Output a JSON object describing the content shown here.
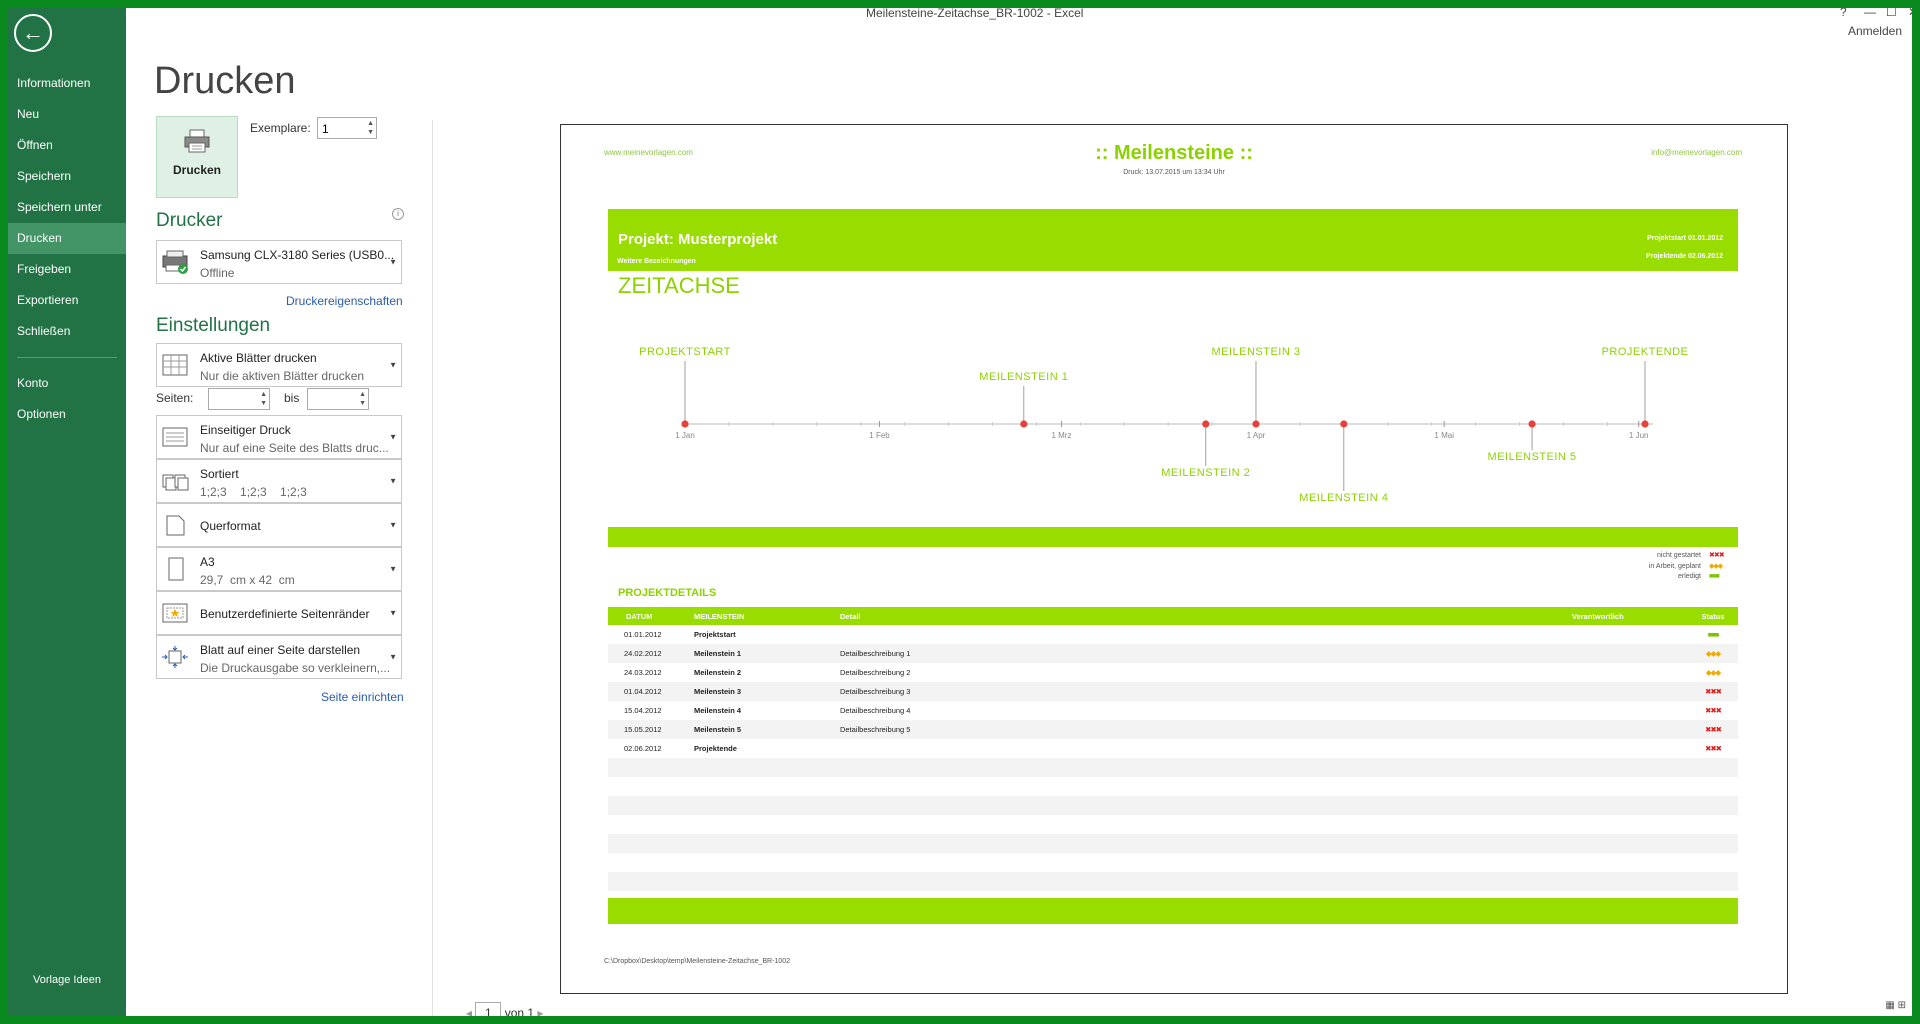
{
  "window": {
    "title": "Meilensteine-Zeitachse_BR-1002 - Excel",
    "help": "?",
    "minimize": "—",
    "maximize": "☐",
    "close": "✕",
    "sign_in": "Anmelden"
  },
  "sidebar": {
    "items": [
      {
        "label": "Informationen"
      },
      {
        "label": "Neu"
      },
      {
        "label": "Öffnen"
      },
      {
        "label": "Speichern"
      },
      {
        "label": "Speichern unter"
      },
      {
        "label": "Drucken"
      },
      {
        "label": "Freigeben"
      },
      {
        "label": "Exportieren"
      },
      {
        "label": "Schließen"
      },
      {
        "label": "Konto"
      },
      {
        "label": "Optionen"
      }
    ],
    "footer": "Vorlage Ideen"
  },
  "print": {
    "heading": "Drucken",
    "button": "Drucken",
    "copies_label": "Exemplare:",
    "copies_value": "1",
    "printer_heading": "Drucker",
    "printer_name": "Samsung CLX-3180 Series (USB0...",
    "printer_status": "Offline",
    "printer_props": "Druckereigenschaften",
    "settings_heading": "Einstellungen",
    "scope_t1": "Aktive Blätter drucken",
    "scope_t2": "Nur die aktiven Blätter drucken",
    "pages_label": "Seiten:",
    "pages_to": "bis",
    "sides_t1": "Einseitiger Druck",
    "sides_t2": "Nur auf eine Seite des Blatts druc...",
    "collate_t1": "Sortiert",
    "collate_t2": "1;2;3    1;2;3    1;2;3",
    "orientation": "Querformat",
    "paper_t1": "A3",
    "paper_t2": "29,7  cm x 42  cm",
    "margins": "Benutzerdefinierte Seitenränder",
    "scale_t1": "Blatt auf einer Seite darstellen",
    "scale_t2": "Die Druckausgabe so verkleinern,...",
    "page_setup": "Seite einrichten"
  },
  "preview": {
    "url_left": "www.meinevorlagen.com",
    "url_right": "info@meinevorlagen.com",
    "title": ":: Meilensteine ::",
    "print_date": "Druck: 13.07.2015 um 13:34 Uhr",
    "project": "Projekt: Musterprojekt",
    "project_sub": "Weitere Bezeichnungen",
    "project_start": "Projektstart  01.01.2012",
    "project_end": "Projektende  02.06.2012",
    "timeline_heading": "ZEITACHSE",
    "legend": [
      {
        "label": "nicht gestartet",
        "symbol": "✖✖✖",
        "color": "#e21a1a"
      },
      {
        "label": "in Arbeit, geplant",
        "symbol": "◆◆◆",
        "color": "#f2a900"
      },
      {
        "label": "erledigt",
        "symbol": "■■■",
        "color": "#7cc300"
      }
    ],
    "details_heading": "PROJEKTDETAILS",
    "table_headers": {
      "date": "DATUM",
      "milestone": "MEILENSTEIN",
      "detail": "Detail",
      "owner": "Verantwortlich",
      "status": "Status"
    },
    "rows": [
      {
        "date": "01.01.2012",
        "milestone": "Projektstart",
        "detail": "",
        "status": "■■■",
        "status_kind": "done"
      },
      {
        "date": "24.02.2012",
        "milestone": "Meilenstein 1",
        "detail": "Detailbeschreibung 1",
        "status": "◆◆◆",
        "status_kind": "planned"
      },
      {
        "date": "24.03.2012",
        "milestone": "Meilenstein 2",
        "detail": "Detailbeschreibung 2",
        "status": "◆◆◆",
        "status_kind": "planned"
      },
      {
        "date": "01.04.2012",
        "milestone": "Meilenstein 3",
        "detail": "Detailbeschreibung 3",
        "status": "✖✖✖",
        "status_kind": "notstarted"
      },
      {
        "date": "15.04.2012",
        "milestone": "Meilenstein 4",
        "detail": "Detailbeschreibung 4",
        "status": "✖✖✖",
        "status_kind": "notstarted"
      },
      {
        "date": "15.05.2012",
        "milestone": "Meilenstein 5",
        "detail": "Detailbeschreibung 5",
        "status": "✖✖✖",
        "status_kind": "notstarted"
      },
      {
        "date": "02.06.2012",
        "milestone": "Projektende",
        "detail": "",
        "status": "✖✖✖",
        "status_kind": "notstarted"
      }
    ],
    "file_path": "C:\\Dropbox\\Desktop\\temp\\Meilensteine-Zeitachse_BR-1002"
  },
  "chart_data": {
    "type": "scatter",
    "title": "ZEITACHSE",
    "x_axis": {
      "type": "date",
      "min": "2012-01-01",
      "max": "2012-06-02",
      "ticks": [
        "1 Jan",
        "1 Feb",
        "1 Mrz",
        "1 Apr",
        "1 Mai",
        "1 Jun"
      ]
    },
    "points": [
      {
        "date": "2012-01-01",
        "label": "PROJEKTSTART",
        "side": "above",
        "level": 2
      },
      {
        "date": "2012-02-24",
        "label": "MEILENSTEIN 1",
        "side": "above",
        "level": 1
      },
      {
        "date": "2012-03-24",
        "label": "MEILENSTEIN 2",
        "side": "below",
        "level": 1
      },
      {
        "date": "2012-04-01",
        "label": "MEILENSTEIN 3",
        "side": "above",
        "level": 2
      },
      {
        "date": "2012-04-15",
        "label": "MEILENSTEIN 4",
        "side": "below",
        "level": 2
      },
      {
        "date": "2012-05-15",
        "label": "MEILENSTEIN 5",
        "side": "below",
        "level": 0
      },
      {
        "date": "2012-06-02",
        "label": "PROJEKTENDE",
        "side": "above",
        "level": 2
      }
    ],
    "marker_color": "#e8413c",
    "label_color": "#8cd200"
  },
  "pager": {
    "current": "1",
    "total_label": "von 1"
  },
  "colors": {
    "accent": "#217346",
    "brand_green": "#99dc00"
  }
}
